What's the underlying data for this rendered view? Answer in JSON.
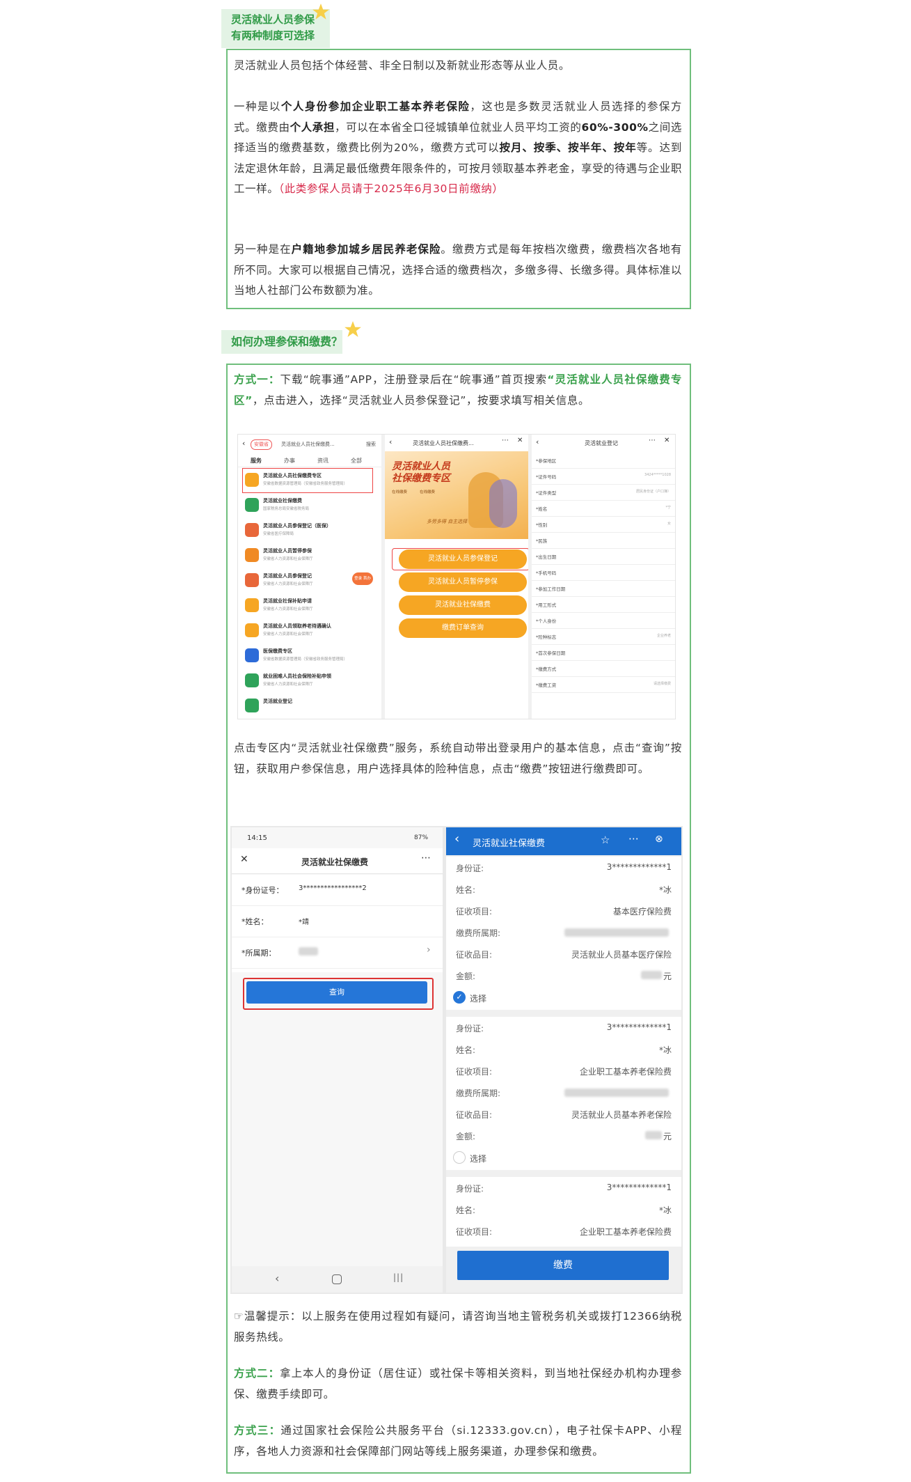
{
  "section1": {
    "title_line1": "灵活就业人员参保",
    "title_line2": "有两种制度可选择",
    "p1": "灵活就业人员包括个体经营、非全日制以及新就业形态等从业人员。",
    "p2_a": "一种是以",
    "p2_b": "个人身份参加企业职工基本养老保险",
    "p2_c": "，这也是多数灵活就业人员选择的参保方式。缴费由",
    "p2_d": "个人承担",
    "p2_e": "，可以在本省全口径城镇单位就业人员平均工资的",
    "p2_f": "60%-300%",
    "p2_g": "之间选择适当的缴费基数，缴费比例为20%，缴费方式可以",
    "p2_h": "按月、按季、按半年、按年",
    "p2_i": "等。达到法定退休年龄，且满足最低缴费年限条件的，可按月领取基本养老金，享受的待遇与企业职工一样。",
    "p2_red": "（此类参保人员请于2025年6月30日前缴纳）",
    "p3_a": "另一种是在",
    "p3_b": "户籍地参加城乡居民养老保险",
    "p3_c": "。缴费方式是每年按档次缴费，缴费档次各地有所不同。大家可以根据自己情况，选择合适的缴费档次，多缴多得、长缴多得。具体标准以当地人社部门公布数额为准。"
  },
  "section2": {
    "title": "如何办理参保和缴费？",
    "m1_label": "方式一：",
    "m1_a": "下载“皖事通”APP，注册登录后在“皖事通”首页搜索",
    "m1_b": "“灵活就业人员社保缴费专区”",
    "m1_c": "，点击进入，选择“灵活就业人员参保登记”，按要求填写相关信息。",
    "mid_text": "点击专区内“灵活就业社保缴费”服务，系统自动带出登录用户的基本信息，点击“查询”按钮，获取用户参保信息，用户选择具体的险种信息，点击“缴费”按钮进行缴费即可。",
    "tip": "☞温馨提示：以上服务在使用过程如有疑问，请咨询当地主管税务机关或拨打12366纳税服务热线。",
    "m2_label": "方式二：",
    "m2_text": "拿上本人的身份证（居住证）或社保卡等相关资料，到当地社保经办机构办理参保、缴费手续即可。",
    "m3_label": "方式三：",
    "m3_text": "通过国家社会保险公共服务平台（si.12333.gov.cn），电子社保卡APP、小程序，各地人力资源和社会保障部门网站等线上服务渠道，办理参保和缴费。"
  },
  "shot1": {
    "left": {
      "province": "安徽省",
      "search_text": "灵活就业人员社保缴费...",
      "search_btn": "搜索",
      "tabs": [
        "服务",
        "办事",
        "资讯",
        "全部"
      ],
      "items": [
        {
          "title": "灵活就业人员社保缴费专区",
          "sub": "安徽省数据资源管理局（安徽省政务服务管理局）"
        },
        {
          "title": "灵活就业社保缴费",
          "sub": "国家税务总局安徽省税务局"
        },
        {
          "title": "灵活就业人员参保登记（医保）",
          "sub": "安徽省医疗保障局"
        },
        {
          "title": "灵活就业人员暂停参保",
          "sub": "安徽省人力资源和社会保障厅"
        },
        {
          "title": "灵活就业人员参保登记",
          "sub": "安徽省人力资源和社会保障厅"
        },
        {
          "title": "灵活就业社保补贴申请",
          "sub": "安徽省人力资源和社会保障厅"
        },
        {
          "title": "灵活就业人员领取养老待遇确认",
          "sub": "安徽省人力资源和社会保障厅"
        },
        {
          "title": "医保缴费专区",
          "sub": "安徽省数据资源管理局（安徽省政务服务管理局）"
        },
        {
          "title": "就业困难人员社会保险补贴申领",
          "sub": "安徽省人力资源和社会保障厅"
        },
        {
          "title": "灵活就业登记",
          "sub": ""
        }
      ],
      "float_badge": "登录 首办"
    },
    "mid": {
      "title": "灵活就业人员社保缴费...",
      "banner_line1": "灵活就业人员",
      "banner_line2": "社保缴费专区",
      "banner_tags": [
        "在线缴费",
        "在线缴费"
      ],
      "banner_small": "多劳多得 自主选择",
      "buttons": [
        "灵活就业人员参保登记",
        "灵活就业人员暂停参保",
        "灵活就业社保缴费",
        "缴费订单查询"
      ]
    },
    "right": {
      "title": "灵活就业登记",
      "fields": [
        {
          "label": "*参保地区",
          "value": ""
        },
        {
          "label": "*证件号码",
          "value": "3424*****1028"
        },
        {
          "label": "*证件类型",
          "value": "居民身份证（户口簿）"
        },
        {
          "label": "*姓名",
          "value": "*宁"
        },
        {
          "label": "*性别",
          "value": "女"
        },
        {
          "label": "*民族",
          "value": ""
        },
        {
          "label": "*出生日期",
          "value": ""
        },
        {
          "label": "*手机号码",
          "value": ""
        },
        {
          "label": "*参加工作日期",
          "value": ""
        },
        {
          "label": "*用工形式",
          "value": ""
        },
        {
          "label": "*个人身份",
          "value": ""
        },
        {
          "label": "*险种标志",
          "value": "企业养老"
        },
        {
          "label": "*首次参保日期",
          "value": ""
        },
        {
          "label": "*缴费方式",
          "value": ""
        },
        {
          "label": "*缴费工资",
          "value": "请选择缴费"
        }
      ]
    }
  },
  "shot2": {
    "left": {
      "time": "14:15",
      "battery": "87%",
      "title": "灵活就业社保缴费",
      "id_label": "*身份证号：",
      "id_value": "3*****************2",
      "name_label": "*姓名：",
      "name_value": "*靖",
      "period_label": "*所属期：",
      "query_btn": "查询"
    },
    "right": {
      "title": "灵活就业社保缴费",
      "records": [
        {
          "id_label": "身份证:",
          "id": "3*************1",
          "name_label": "姓名:",
          "name": "*冰",
          "item_label": "征收项目:",
          "item": "基本医疗保险费",
          "period_label": "缴费所属期:",
          "sub_label": "征收品目:",
          "sub": "灵活就业人员基本医疗保险",
          "amt_label": "金额:",
          "amt_unit": "元",
          "select": "选择"
        },
        {
          "id_label": "身份证:",
          "id": "3*************1",
          "name_label": "姓名:",
          "name": "*冰",
          "item_label": "征收项目:",
          "item": "企业职工基本养老保险费",
          "period_label": "缴费所属期:",
          "sub_label": "征收品目:",
          "sub": "灵活就业人员基本养老保险",
          "amt_label": "金额:",
          "amt_unit": "元",
          "select": "选择"
        },
        {
          "id_label": "身份证:",
          "id": "3*************1",
          "name_label": "姓名:",
          "name": "*冰",
          "item_label": "征收项目:",
          "item": "企业职工基本养老保险费"
        }
      ],
      "pay_btn": "缴费"
    }
  },
  "colors": {
    "green": "#3aa14c",
    "red": "#d7294a",
    "orange": "#f6a623",
    "blue": "#1f6fd0"
  }
}
